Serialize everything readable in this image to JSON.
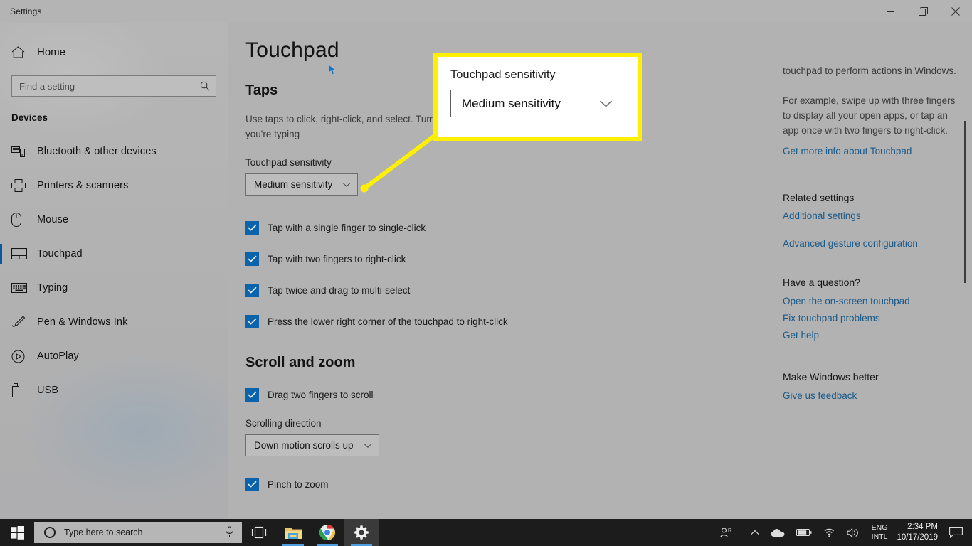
{
  "window": {
    "title": "Settings",
    "controls": {
      "minimize": "minimize-icon",
      "maximize": "maximize-icon",
      "close": "close-icon"
    }
  },
  "sidebar": {
    "home_label": "Home",
    "search": {
      "placeholder": "Find a setting",
      "value": "",
      "icon": "search-icon"
    },
    "category": "Devices",
    "items": [
      {
        "label": "Bluetooth & other devices",
        "icon": "bluetooth-devices-icon",
        "selected": false
      },
      {
        "label": "Printers & scanners",
        "icon": "printer-icon",
        "selected": false
      },
      {
        "label": "Mouse",
        "icon": "mouse-icon",
        "selected": false
      },
      {
        "label": "Touchpad",
        "icon": "touchpad-icon",
        "selected": true
      },
      {
        "label": "Typing",
        "icon": "keyboard-icon",
        "selected": false
      },
      {
        "label": "Pen & Windows Ink",
        "icon": "pen-icon",
        "selected": false
      },
      {
        "label": "AutoPlay",
        "icon": "autoplay-icon",
        "selected": false
      },
      {
        "label": "USB",
        "icon": "usb-icon",
        "selected": false
      }
    ]
  },
  "main": {
    "page_title": "Touchpad",
    "taps": {
      "heading": "Taps",
      "description": "Use taps to click, right-click, and select. Turn off taps to prevent the cursor from activate while you're typing",
      "sensitivity_label": "Touchpad sensitivity",
      "sensitivity_value": "Medium sensitivity",
      "checkboxes": [
        {
          "label": "Tap with a single finger to single-click",
          "checked": true
        },
        {
          "label": "Tap with two fingers to right-click",
          "checked": true
        },
        {
          "label": "Tap twice and drag to multi-select",
          "checked": true
        },
        {
          "label": "Press the lower right corner of the touchpad to right-click",
          "checked": true
        }
      ]
    },
    "scroll_zoom": {
      "heading": "Scroll and zoom",
      "drag_label": "Drag two fingers to scroll",
      "drag_checked": true,
      "direction_label": "Scrolling direction",
      "direction_value": "Down motion scrolls up",
      "pinch_label": "Pinch to zoom",
      "pinch_checked": true
    }
  },
  "info_pane": {
    "paragraph_1": "touchpad to perform actions in Windows.",
    "paragraph_2": "For example, swipe up with three fingers to display all your open apps, or tap an app once with two fingers to right-click.",
    "link_more_info": "Get more info about Touchpad",
    "related_heading": "Related settings",
    "related_links": [
      "Additional settings",
      "Advanced gesture configuration"
    ],
    "question_heading": "Have a question?",
    "question_links": [
      "Open the on-screen touchpad",
      "Fix touchpad problems",
      "Get help"
    ],
    "feedback_heading": "Make Windows better",
    "feedback_link": "Give us feedback"
  },
  "callout": {
    "label": "Touchpad sensitivity",
    "value": "Medium sensitivity",
    "border_color": "#ffef00",
    "background": "#ffffff"
  },
  "taskbar": {
    "start_icon": "windows-start-icon",
    "search_placeholder": "Type here to search",
    "search_value": "",
    "mic_icon": "microphone-icon",
    "taskview_icon": "task-view-icon",
    "apps": [
      {
        "name": "file-explorer-icon",
        "running": true,
        "active": false
      },
      {
        "name": "google-chrome-icon",
        "running": true,
        "active": false
      },
      {
        "name": "settings-gear-icon",
        "running": true,
        "active": true
      }
    ],
    "tray": {
      "people_icon": "people-icon",
      "chevron_icon": "show-hidden-icons-icon",
      "onedrive_icon": "onedrive-cloud-icon",
      "battery_icon": "battery-icon",
      "wifi_icon": "wifi-icon",
      "volume_icon": "volume-icon",
      "language_line1": "ENG",
      "language_line2": "INTL",
      "time": "2:34 PM",
      "date": "10/17/2019",
      "action_center_icon": "action-center-icon"
    }
  },
  "colors": {
    "accent": "#0b63ab",
    "link": "#1b5b8a",
    "highlight": "#ffef00",
    "taskbar": "#1c1c1c"
  }
}
